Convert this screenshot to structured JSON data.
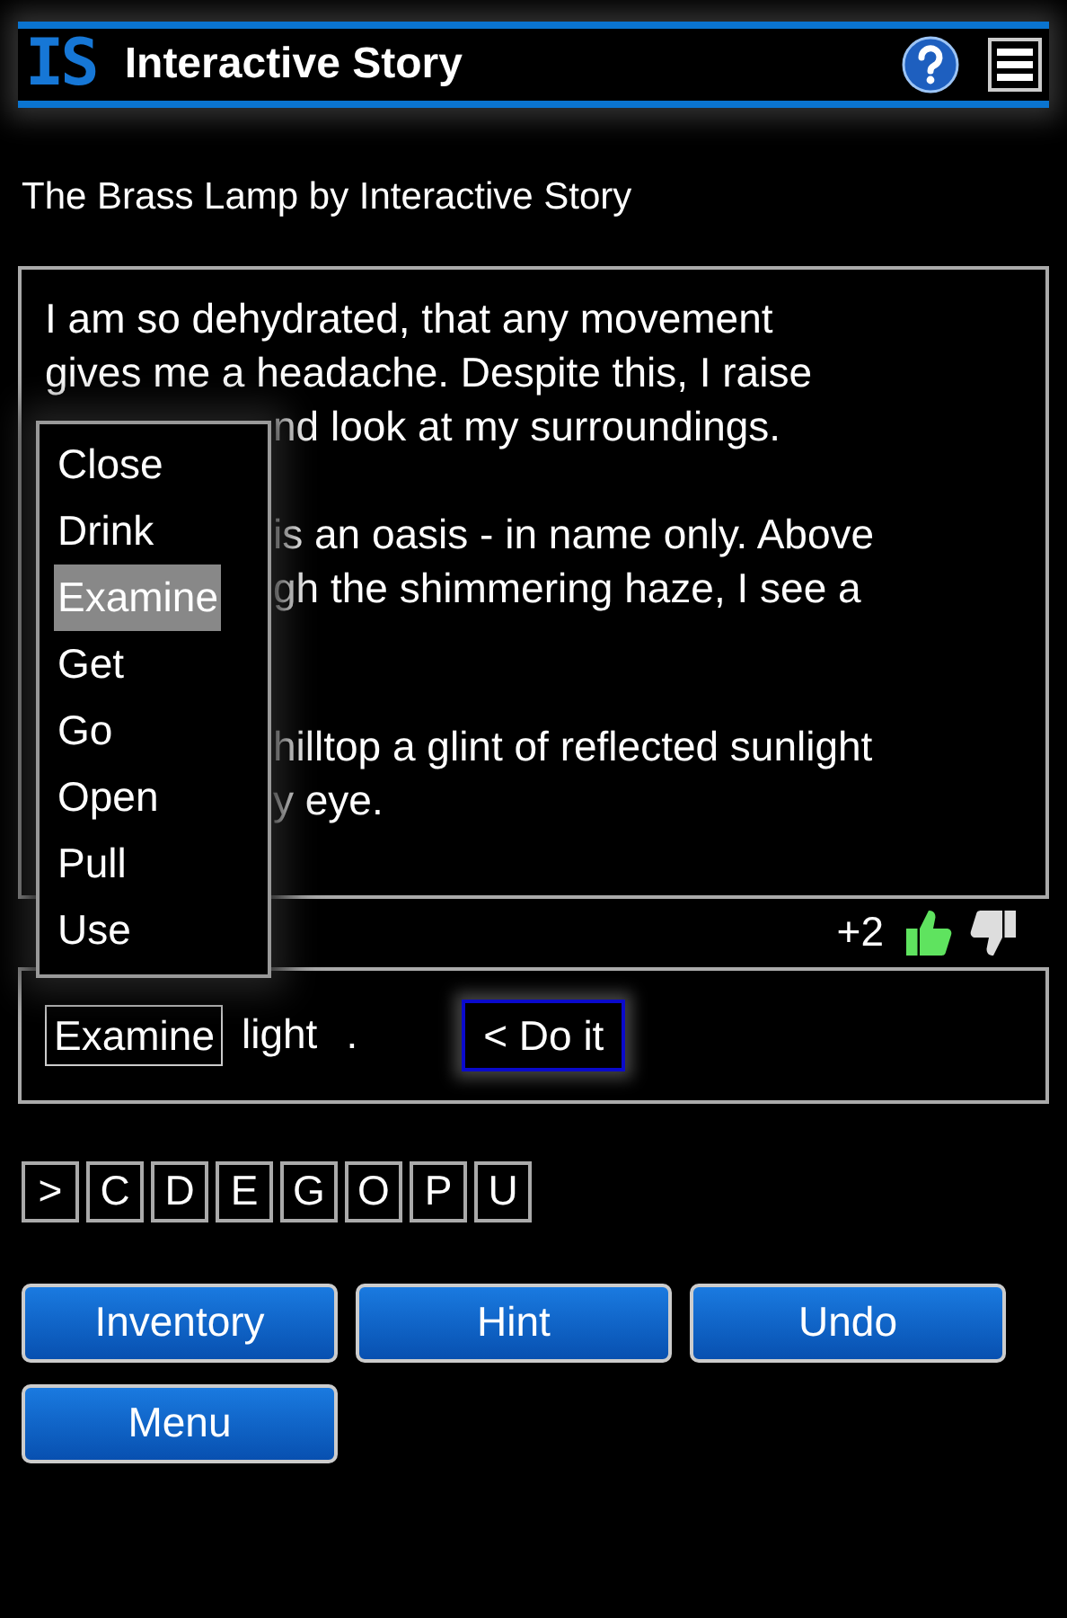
{
  "header": {
    "logo": "IS",
    "title": "Interactive Story"
  },
  "story_title": "The Brass Lamp by Interactive Story",
  "story": {
    "paragraphs": [
      {
        "lines": [
          {
            "text": "I am so dehydrated, that any movement",
            "kind": "full"
          },
          {
            "text": "gives me a headache. Despite this, I raise",
            "kind": "full"
          },
          {
            "text": "nd look at my surroundings.",
            "kind": "partial"
          }
        ]
      },
      {
        "lines": [
          {
            "text": "is an oasis - in name only. Above",
            "kind": "partial"
          },
          {
            "text": "gh the shimmering haze, I see a",
            "kind": "partial"
          }
        ]
      },
      {
        "lines": [
          {
            "text": "hilltop a glint of reflected sunlight",
            "kind": "partial"
          },
          {
            "text": "y eye.",
            "kind": "partial"
          }
        ]
      }
    ]
  },
  "verb_menu": [
    {
      "label": "Close",
      "selected": false
    },
    {
      "label": "Drink",
      "selected": false
    },
    {
      "label": "Examine",
      "selected": true
    },
    {
      "label": "Get",
      "selected": false
    },
    {
      "label": "Go",
      "selected": false
    },
    {
      "label": "Open",
      "selected": false
    },
    {
      "label": "Pull",
      "selected": false
    },
    {
      "label": "Use",
      "selected": false
    }
  ],
  "rating": {
    "score": "+2"
  },
  "command": {
    "verb": "Examine",
    "object": "light",
    "end": ".",
    "submit": "< Do it"
  },
  "letter_keys": [
    ">",
    "C",
    "D",
    "E",
    "G",
    "O",
    "P",
    "U"
  ],
  "buttons": [
    "Inventory",
    "Hint",
    "Undo",
    "Menu"
  ]
}
